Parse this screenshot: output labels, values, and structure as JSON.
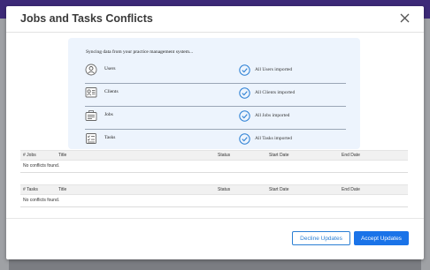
{
  "modal": {
    "title": "Jobs and Tasks Conflicts"
  },
  "sync": {
    "heading": "Syncing data from your practice management system...",
    "items": [
      {
        "label": "Users",
        "status": "All Users imported",
        "icon": "users-icon"
      },
      {
        "label": "Clients",
        "status": "All Clients imported",
        "icon": "clients-icon"
      },
      {
        "label": "Jobs",
        "status": "All Jobs imported",
        "icon": "jobs-icon"
      },
      {
        "label": "Tasks",
        "status": "All Tasks imported",
        "icon": "tasks-icon"
      }
    ]
  },
  "jobs_table": {
    "columns": [
      "# Jobs",
      "Title",
      "Status",
      "Start Date",
      "End Date"
    ],
    "empty_text": "No conflicts found."
  },
  "tasks_table": {
    "columns": [
      "# Tasks",
      "Title",
      "Status",
      "Start Date",
      "End Date"
    ],
    "empty_text": "No conflicts found."
  },
  "footer": {
    "decline_label": "Decline Updates",
    "accept_label": "Accept Updates"
  },
  "colors": {
    "top_bar": "#3d2a78",
    "panel_bg": "#edf4fd",
    "accent": "#1a73e8",
    "check": "#2b7fd4"
  }
}
